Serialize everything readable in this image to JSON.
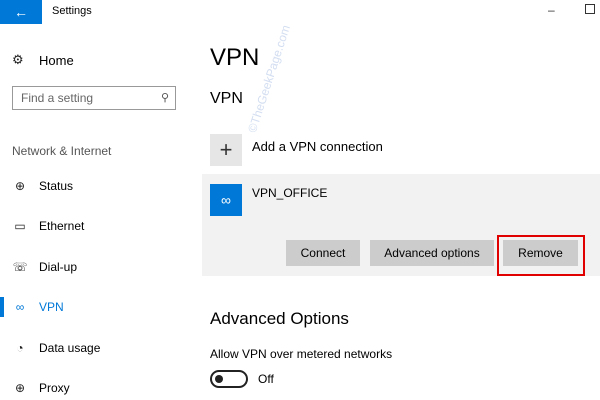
{
  "window": {
    "title": "Settings",
    "back_icon": "back-arrow-icon",
    "minimize_glyph": "–",
    "maximize_icon": "maximize-icon"
  },
  "sidebar": {
    "home": {
      "icon": "gear-icon",
      "glyph": "⚙",
      "label": "Home"
    },
    "search": {
      "placeholder": "Find a setting",
      "icon": "search-icon",
      "glyph": "⚲"
    },
    "section_label": "Network & Internet",
    "items": [
      {
        "icon": "globe-icon",
        "glyph": "⊕",
        "label": "Status",
        "active": false
      },
      {
        "icon": "ethernet-icon",
        "glyph": "▭",
        "label": "Ethernet",
        "active": false
      },
      {
        "icon": "dialup-icon",
        "glyph": "☏",
        "label": "Dial-up",
        "active": false
      },
      {
        "icon": "vpn-icon",
        "glyph": "∞",
        "label": "VPN",
        "active": true
      },
      {
        "icon": "data-usage-icon",
        "glyph": "◔",
        "label": "Data usage",
        "active": false
      },
      {
        "icon": "proxy-icon",
        "glyph": "⊕",
        "label": "Proxy",
        "active": false
      }
    ]
  },
  "main": {
    "title": "VPN",
    "subtitle": "VPN",
    "add_connection": {
      "icon": "plus-icon",
      "glyph": "+",
      "label": "Add a VPN connection"
    },
    "connection": {
      "icon": "vpn-connection-icon",
      "glyph": "∞",
      "name": "VPN_OFFICE",
      "buttons": {
        "connect": "Connect",
        "advanced": "Advanced options",
        "remove": "Remove"
      }
    },
    "advanced": {
      "heading": "Advanced Options",
      "metered_label": "Allow VPN over metered networks",
      "metered_state": "Off"
    }
  },
  "watermark": "©TheGeekPage.com",
  "colors": {
    "accent": "#0078d7",
    "highlight": "#e00000",
    "button_bg": "#cccccc",
    "card_bg": "#f2f2f2"
  }
}
